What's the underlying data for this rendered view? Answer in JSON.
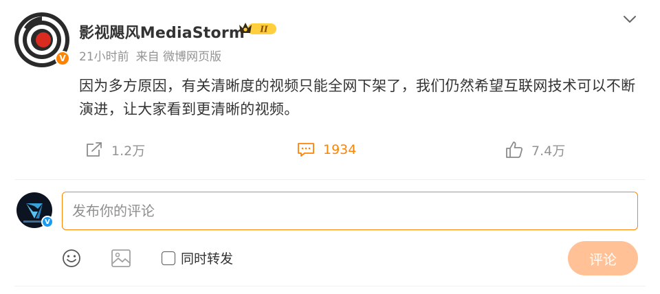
{
  "post": {
    "author": {
      "name": "影视飓风MediaStorm",
      "verified_mark": "V",
      "level_badge": "II",
      "avatar_icon": "mediastorm-logo"
    },
    "meta": {
      "time": "21小时前",
      "source": "来自 微博网页版"
    },
    "text": "因为多方原因，有关清晰度的视频只能全网下架了，我们仍然希望互联网技术可以不断演进，让大家看到更清晰的视频。",
    "actions": {
      "repost_count": "1.2万",
      "comment_count": "1934",
      "like_count": "7.4万"
    }
  },
  "comment_box": {
    "placeholder": "发布你的评论",
    "value": "",
    "forward_label": "同时转发",
    "submit_label": "评论",
    "user_verified_mark": "V"
  },
  "colors": {
    "accent": "#ff8200",
    "submit_disabled": "#ffc195",
    "text_primary": "#333333",
    "text_secondary": "#939393",
    "verified_blue": "#1d9bf0"
  }
}
